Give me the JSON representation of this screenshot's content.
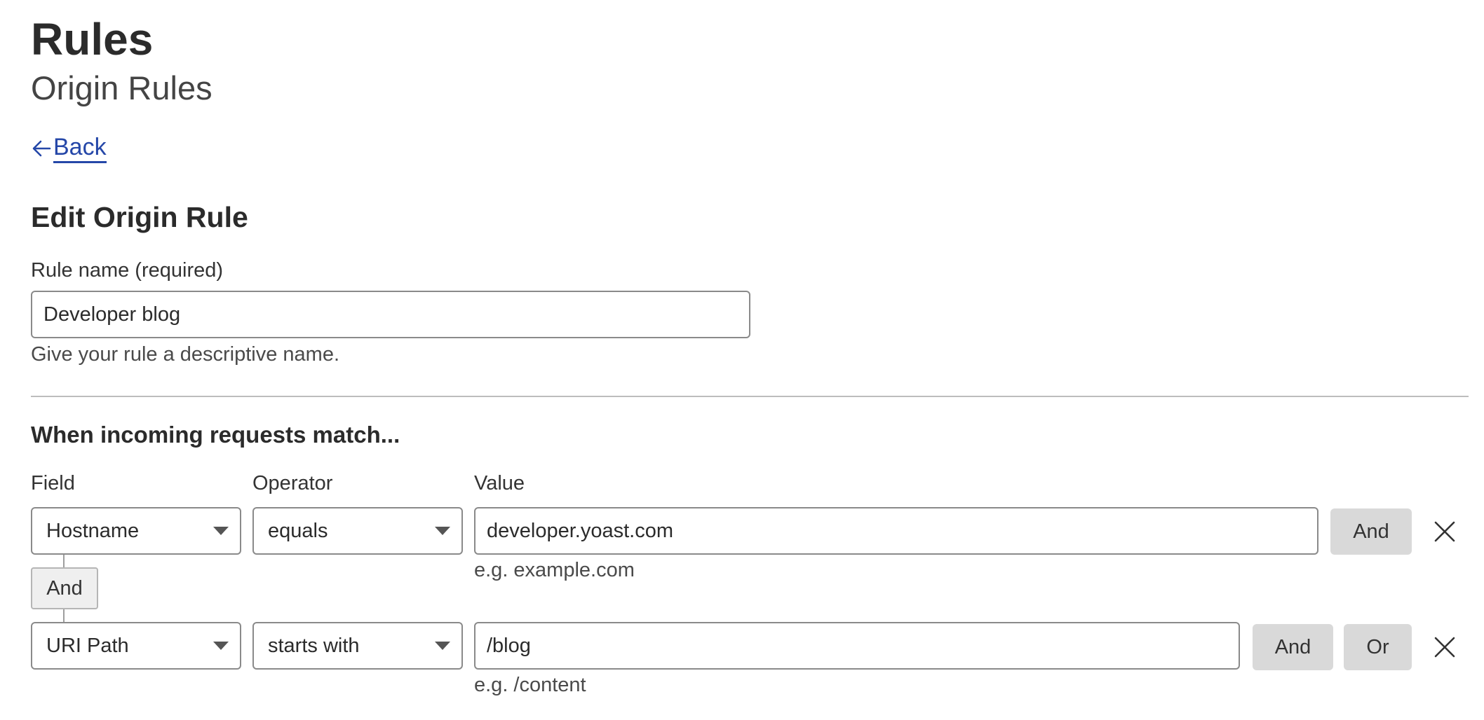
{
  "header": {
    "title": "Rules",
    "subtitle": "Origin Rules"
  },
  "nav": {
    "back_label": "Back",
    "back_icon": "arrow-left-icon"
  },
  "form": {
    "title": "Edit Origin Rule",
    "rule_name": {
      "label": "Rule name (required)",
      "value": "Developer blog",
      "help": "Give your rule a descriptive name."
    }
  },
  "match": {
    "title": "When incoming requests match...",
    "columns": {
      "field": "Field",
      "operator": "Operator",
      "value": "Value"
    },
    "connector_label": "And",
    "rows": [
      {
        "field": "Hostname",
        "operator": "equals",
        "value": "developer.yoast.com",
        "example": "e.g. example.com",
        "and_label": "And"
      },
      {
        "field": "URI Path",
        "operator": "starts with",
        "value": "/blog",
        "example": "e.g. /content",
        "and_label": "And",
        "or_label": "Or"
      }
    ]
  },
  "colors": {
    "link": "#2547a8",
    "text": "#313131",
    "button_bg": "#d9d9d9",
    "border": "#8a8a8a"
  }
}
